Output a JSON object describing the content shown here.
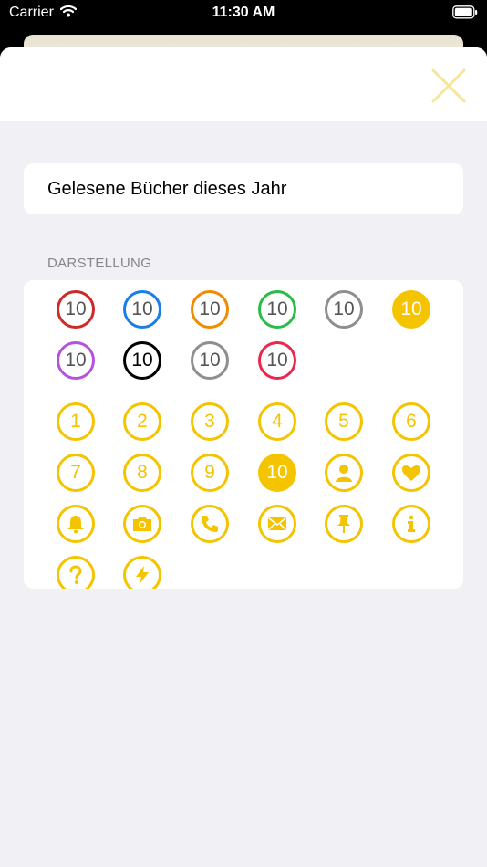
{
  "status_bar": {
    "carrier": "Carrier",
    "time": "11:30 AM"
  },
  "form": {
    "title_value": "Gelesene Bücher dieses Jahr",
    "section_header": "DARSTELLUNG"
  },
  "colors": {
    "accent": "#f5c400",
    "close_icon": "#f7e59a",
    "sheet_background": "#f0f0f5",
    "options": [
      "#cc2b2b",
      "#1a7ee6",
      "#f08c00",
      "#2bbb4a",
      "#8e8e93",
      "#f5c400",
      "#b552de",
      "#000000",
      "#8e8e93",
      "#e8284f"
    ]
  },
  "color_options": [
    {
      "label": "10",
      "color": "#cc2b2b",
      "filled": false
    },
    {
      "label": "10",
      "color": "#1a7ee6",
      "filled": false
    },
    {
      "label": "10",
      "color": "#f08c00",
      "filled": false
    },
    {
      "label": "10",
      "color": "#2bbb4a",
      "filled": false
    },
    {
      "label": "10",
      "color": "#8e8e93",
      "filled": false
    },
    {
      "label": "10",
      "color": "#f5c400",
      "filled": true
    },
    {
      "label": "10",
      "color": "#b552de",
      "filled": false
    },
    {
      "label": "10",
      "color": "#000000",
      "filled": false
    },
    {
      "label": "10",
      "color": "#8e8e93",
      "filled": false
    },
    {
      "label": "10",
      "color": "#e8284f",
      "filled": false
    }
  ],
  "symbol_options": [
    {
      "label": "1",
      "icon": "",
      "filled": false
    },
    {
      "label": "2",
      "icon": "",
      "filled": false
    },
    {
      "label": "3",
      "icon": "",
      "filled": false
    },
    {
      "label": "4",
      "icon": "",
      "filled": false
    },
    {
      "label": "5",
      "icon": "",
      "filled": false
    },
    {
      "label": "6",
      "icon": "",
      "filled": false
    },
    {
      "label": "7",
      "icon": "",
      "filled": false
    },
    {
      "label": "8",
      "icon": "",
      "filled": false
    },
    {
      "label": "9",
      "icon": "",
      "filled": false
    },
    {
      "label": "10",
      "icon": "",
      "filled": true
    },
    {
      "label": "",
      "icon": "person-icon",
      "filled": false
    },
    {
      "label": "",
      "icon": "heart-icon",
      "filled": false
    },
    {
      "label": "",
      "icon": "bell-icon",
      "filled": false
    },
    {
      "label": "",
      "icon": "camera-icon",
      "filled": false
    },
    {
      "label": "",
      "icon": "phone-icon",
      "filled": false
    },
    {
      "label": "",
      "icon": "envelope-icon",
      "filled": false
    },
    {
      "label": "",
      "icon": "pin-icon",
      "filled": false
    },
    {
      "label": "",
      "icon": "info-icon",
      "filled": false
    },
    {
      "label": "",
      "icon": "question-icon",
      "filled": false
    },
    {
      "label": "",
      "icon": "bolt-icon",
      "filled": false
    }
  ]
}
